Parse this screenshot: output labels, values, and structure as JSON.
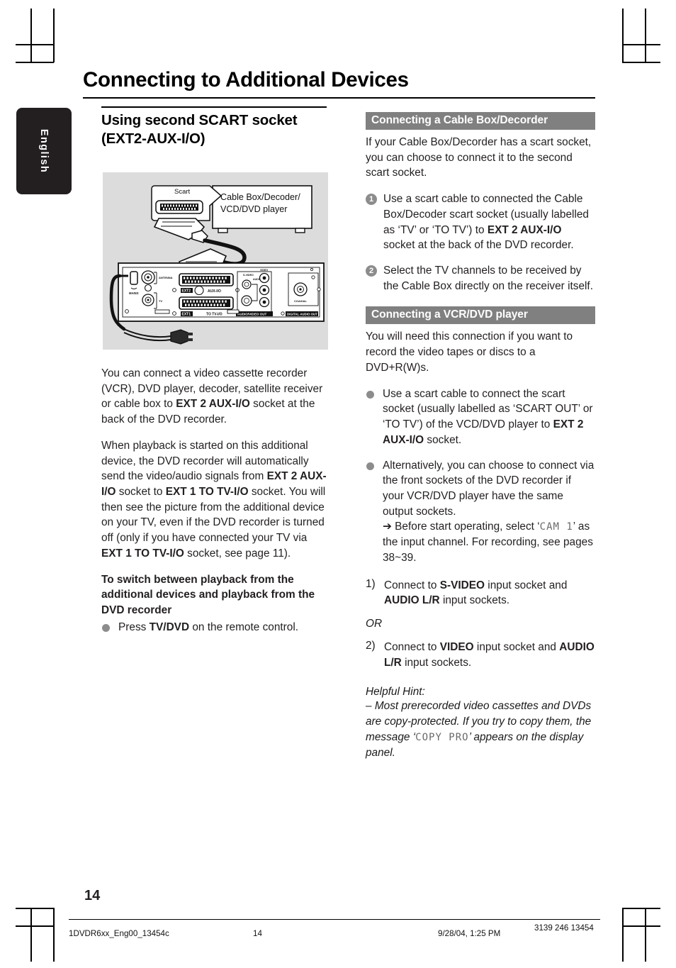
{
  "document": {
    "page_title": "Connecting to Additional Devices",
    "page_number": "14",
    "language_tab": "English"
  },
  "left_column": {
    "sub_heading_line1": "Using second SCART socket",
    "sub_heading_line2": "(EXT2-AUX-I/O)",
    "paragraph_1": {
      "part1": "You can connect a video cassette recorder (VCR), DVD player, decoder, satellite receiver or cable box to ",
      "bold1": "EXT 2 AUX-I/O",
      "part2": " socket at the back of the DVD recorder."
    },
    "paragraph_2": {
      "part1": "When playback is started on this additional device, the DVD recorder will automatically send the video/audio signals from ",
      "bold1": "EXT 2 AUX-I/O",
      "part2": " socket to ",
      "bold2": "EXT 1 TO TV-I/O",
      "part3": " socket. You will then see the picture from the additional device on your TV, even if the DVD recorder is turned off (only if you have connected your TV via ",
      "bold3": "EXT 1 TO TV-I/O",
      "part4": " socket, see page 11)."
    },
    "switch_heading": "To switch between playback from the additional devices and playback from the DVD recorder",
    "switch_item": {
      "part1": "Press ",
      "bold1": "TV/DVD",
      "part2": " on the remote control."
    }
  },
  "figure": {
    "scart_label": "Scart",
    "device_label_line1": "Cable Box/Decoder/",
    "device_label_line2": "VCD/DVD player",
    "panel_labels": {
      "mains": "MAINS",
      "antenna": "ANTENNA",
      "tv": "TV",
      "ext2": "EXT2",
      "aux_io": "AUX-I/O",
      "ext1": "EXT1",
      "to_tv_io": "TO TV-I/O",
      "video": "VIDEO",
      "s_video": "S-VIDEO",
      "audio": "AUDIO",
      "audio_video_out": "AUDIO/VIDEO OUT",
      "coaxial": "COAXIAL",
      "digital_audio_out": "DIGITAL AUDIO OUT"
    }
  },
  "right_column": {
    "section_cable_box": {
      "bar_label": "Connecting a Cable Box/Decorder",
      "intro": "If your Cable Box/Decorder has a scart socket, you can choose to connect it to the second scart socket.",
      "steps": [
        {
          "number": "1",
          "part1": "Use a scart cable to connected the Cable Box/Decoder scart socket (usually labelled as ‘TV’ or ‘TO TV’) to ",
          "bold1": "EXT 2 AUX-I/O",
          "part2": " socket at the back of the DVD recorder."
        },
        {
          "number": "2",
          "part1": "Select the TV channels to be received by the Cable Box directly on the receiver itself.",
          "bold1": "",
          "part2": ""
        }
      ]
    },
    "section_vcr_dvd": {
      "bar_label": "Connecting a VCR/DVD player",
      "intro": "You will need this connection if you want to record the video tapes or discs to a DVD+R(W)s.",
      "bullets": [
        {
          "part1": "Use a scart cable to connect the scart socket (usually labelled as ‘SCART OUT’ or ‘TO TV’) of the VCD/DVD player to ",
          "bold1": "EXT 2 AUX-I/O",
          "part2": " socket."
        }
      ],
      "bullet_alternative": {
        "part1": "Alternatively, you can choose to connect via the front sockets of the DVD recorder if your VCR/DVD player have the same output sockets.",
        "arrow_part1": "➔ Before start operating, select ‘",
        "lcd_text": "CAM 1",
        "arrow_part2": "’ as the input channel.  For recording, see pages 38~39."
      },
      "numbered_options": [
        {
          "label": "1)",
          "part1": "Connect to ",
          "bold1": "S-VIDEO",
          "part2": " input socket and ",
          "bold2": "AUDIO L/R",
          "part3": " input sockets."
        },
        {
          "label": "2)",
          "part1": "Connect to ",
          "bold1": "VIDEO",
          "part2": " input socket and ",
          "bold2": "AUDIO L/R",
          "part3": " input sockets."
        }
      ],
      "or_label": "OR",
      "helpful_hint_heading": "Helpful Hint:",
      "helpful_hint": {
        "part1": "–  Most prerecorded video cassettes and DVDs are copy-protected. If you try to copy them, the message ‘",
        "lcd_text": "COPY PRO",
        "part2": "’ appears on the display panel."
      }
    }
  },
  "footer": {
    "file_name": "1DVDR6xx_Eng00_13454c",
    "page": "14",
    "date": "9/28/04, 1:25 PM",
    "code": "3139 246 13454"
  },
  "colors": {
    "bar_gray": "#808080",
    "bullet_gray": "#8c8c8c",
    "tab_dark": "#231f20",
    "figure_bg": "#dcdcdc",
    "text": "#231f20"
  }
}
